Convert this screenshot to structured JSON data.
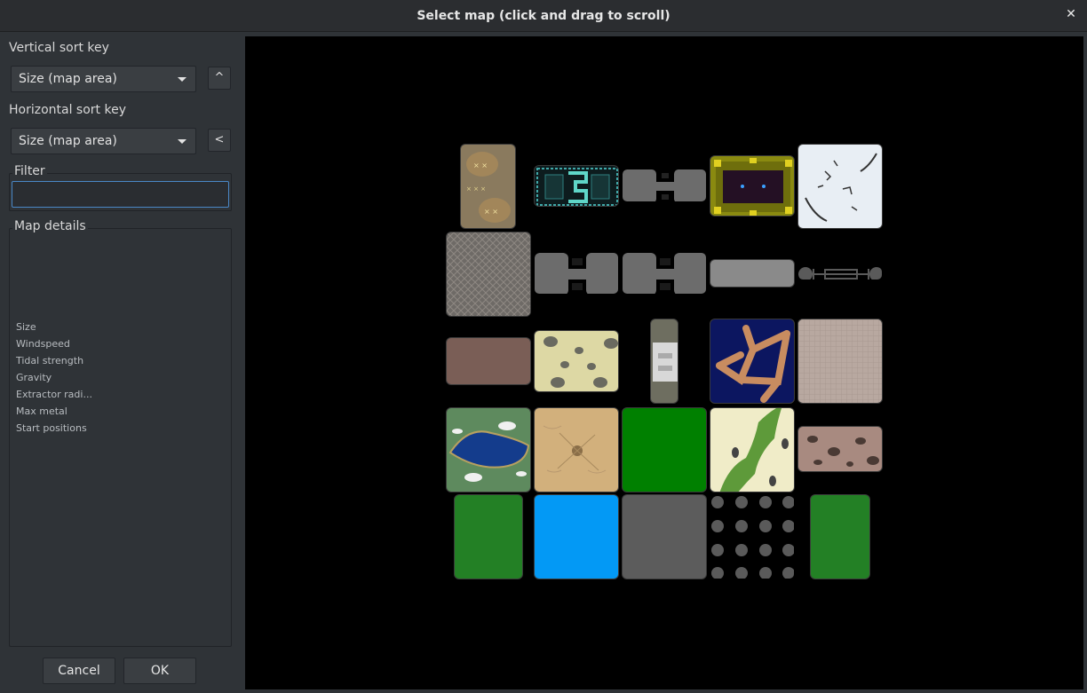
{
  "window": {
    "title": "Select map (click and drag to scroll)",
    "close_glyph": "✕"
  },
  "sidebar": {
    "vertical_sort_label": "Vertical sort key",
    "vertical_sort_value": "Size (map area)",
    "vertical_dir_glyph": "^",
    "horizontal_sort_label": "Horizontal sort key",
    "horizontal_sort_value": "Size (map area)",
    "horizontal_dir_glyph": "<",
    "filter_label": "Filter",
    "filter_value": "",
    "details_label": "Map details",
    "details": [
      "Size",
      "Windspeed",
      "Tidal strength",
      "Gravity",
      "Extractor radi...",
      "Max metal",
      "Start positions"
    ]
  },
  "buttons": {
    "cancel": "Cancel",
    "ok": "OK"
  },
  "icons": {
    "close": "close-icon",
    "dropdown": "chevron-down-icon"
  },
  "colors": {
    "background": "#2f3337",
    "map_area": "#000000",
    "focus_border": "#4a88c7",
    "green_tile": "#238025",
    "blue_tile": "#0399f5",
    "grey_tile": "#5c5c5c",
    "bright_green_tile": "#008000"
  },
  "maps": [
    {
      "name": "map-tile-sand-crosses"
    },
    {
      "name": "map-tile-teal-circuit"
    },
    {
      "name": "map-tile-grey-bridge-a"
    },
    {
      "name": "map-tile-yellow-fortress"
    },
    {
      "name": "map-tile-white-ice"
    },
    {
      "name": "map-tile-grey-mesh"
    },
    {
      "name": "map-tile-grey-bridge-b"
    },
    {
      "name": "map-tile-grey-bridge-c"
    },
    {
      "name": "map-tile-grey-flat"
    },
    {
      "name": "map-tile-grey-axle"
    },
    {
      "name": "map-tile-brown-flat"
    },
    {
      "name": "map-tile-yellow-craters"
    },
    {
      "name": "map-tile-narrow-lane"
    },
    {
      "name": "map-tile-navy-star"
    },
    {
      "name": "map-tile-beige-grid"
    },
    {
      "name": "map-tile-lake"
    },
    {
      "name": "map-tile-dunes"
    },
    {
      "name": "map-tile-green-square"
    },
    {
      "name": "map-tile-desert-green"
    },
    {
      "name": "map-tile-rocky-pink"
    },
    {
      "name": "map-tile-green-a"
    },
    {
      "name": "map-tile-blue"
    },
    {
      "name": "map-tile-grey-square"
    },
    {
      "name": "map-tile-dots"
    },
    {
      "name": "map-tile-green-b"
    }
  ]
}
